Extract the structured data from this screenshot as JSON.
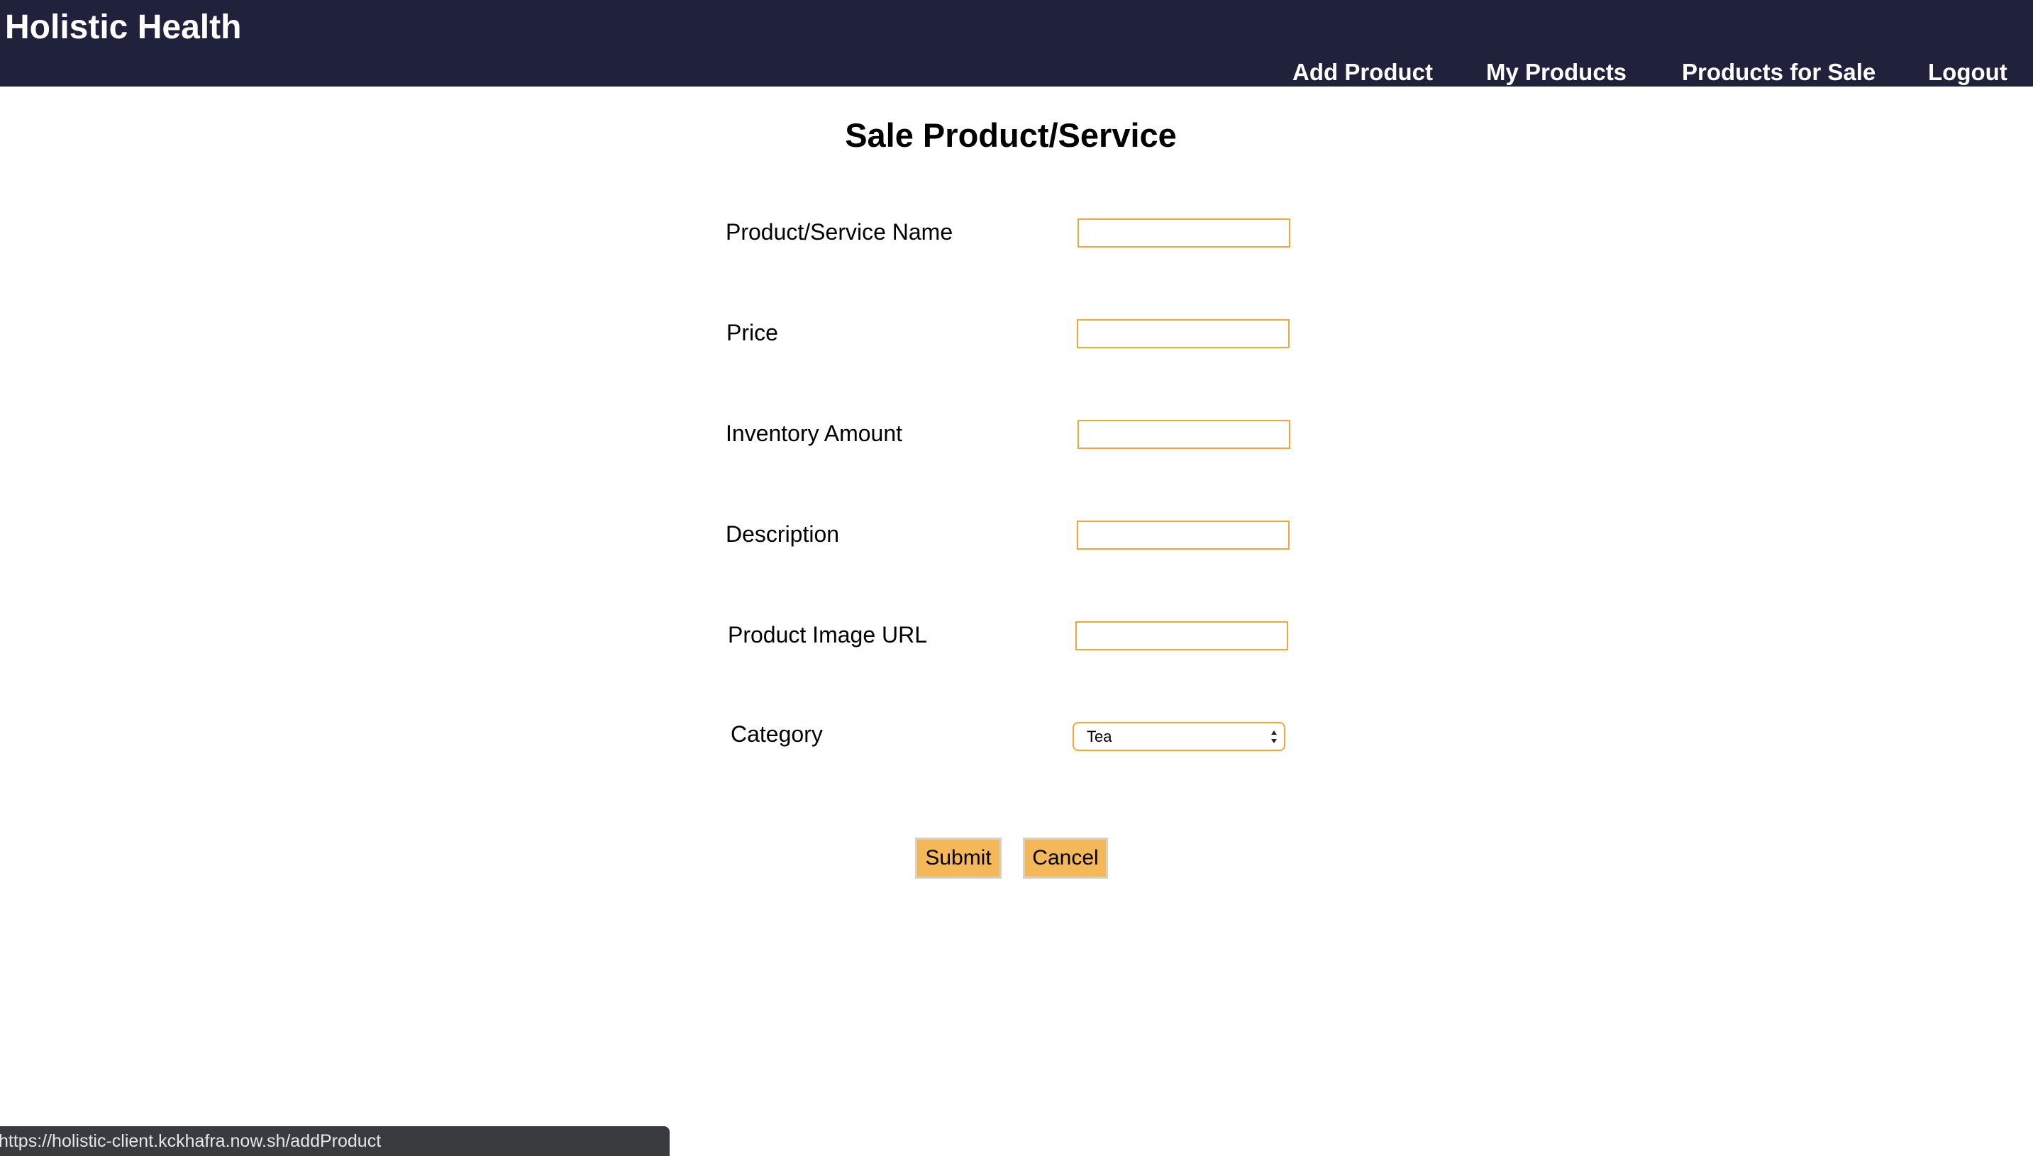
{
  "header": {
    "brand": "Holistic Health",
    "nav": [
      {
        "label": "Add Product"
      },
      {
        "label": "My Products"
      },
      {
        "label": "Products for Sale"
      },
      {
        "label": "Logout"
      }
    ]
  },
  "main": {
    "title": "Sale Product/Service",
    "fields": [
      {
        "label": "Product/Service Name",
        "value": "",
        "placeholder": ""
      },
      {
        "label": "Price",
        "value": "",
        "placeholder": ""
      },
      {
        "label": "Inventory Amount",
        "value": "",
        "placeholder": ""
      },
      {
        "label": "Description",
        "value": "",
        "placeholder": ""
      },
      {
        "label": "Product Image URL",
        "value": "",
        "placeholder": ""
      }
    ],
    "category": {
      "label": "Category",
      "selected": "Tea"
    },
    "buttons": {
      "submit": "Submit",
      "cancel": "Cancel"
    }
  },
  "status_bar": {
    "url": "https://holistic-client.kckhafra.now.sh/addProduct"
  },
  "colors": {
    "header_bg": "#20213a",
    "input_border": "#f0a73a",
    "button_bg": "#f4b858"
  },
  "icons": {
    "select_arrows": "updown-arrows-icon"
  }
}
